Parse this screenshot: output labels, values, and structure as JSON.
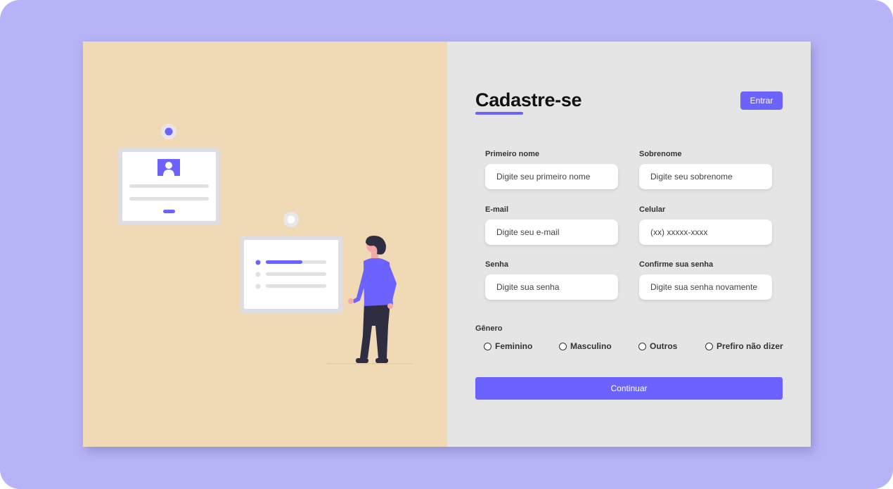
{
  "form": {
    "title": "Cadastre-se",
    "login_label": "Entrar",
    "fields": [
      {
        "label": "Primeiro nome",
        "placeholder": "Digite seu primeiro nome"
      },
      {
        "label": "Sobrenome",
        "placeholder": "Digite seu sobrenome"
      },
      {
        "label": "E-mail",
        "placeholder": "Digite seu e-mail"
      },
      {
        "label": "Celular",
        "placeholder": "(xx) xxxxx-xxxx"
      },
      {
        "label": "Senha",
        "placeholder": "Digite sua senha"
      },
      {
        "label": "Confirme sua senha",
        "placeholder": "Digite sua senha novamente"
      }
    ],
    "gender": {
      "label": "Gênero",
      "options": [
        "Feminino",
        "Masculino",
        "Outros",
        "Prefiro não dizer"
      ]
    },
    "continue_label": "Continuar"
  },
  "colors": {
    "accent": "#6c63ff",
    "background": "#b6b4f6",
    "illustration_panel": "#f0dab6",
    "form_panel": "#e5e5e5"
  },
  "illustration": {
    "icons": [
      "id-card-icon",
      "checklist-card-icon",
      "person-figure"
    ]
  }
}
